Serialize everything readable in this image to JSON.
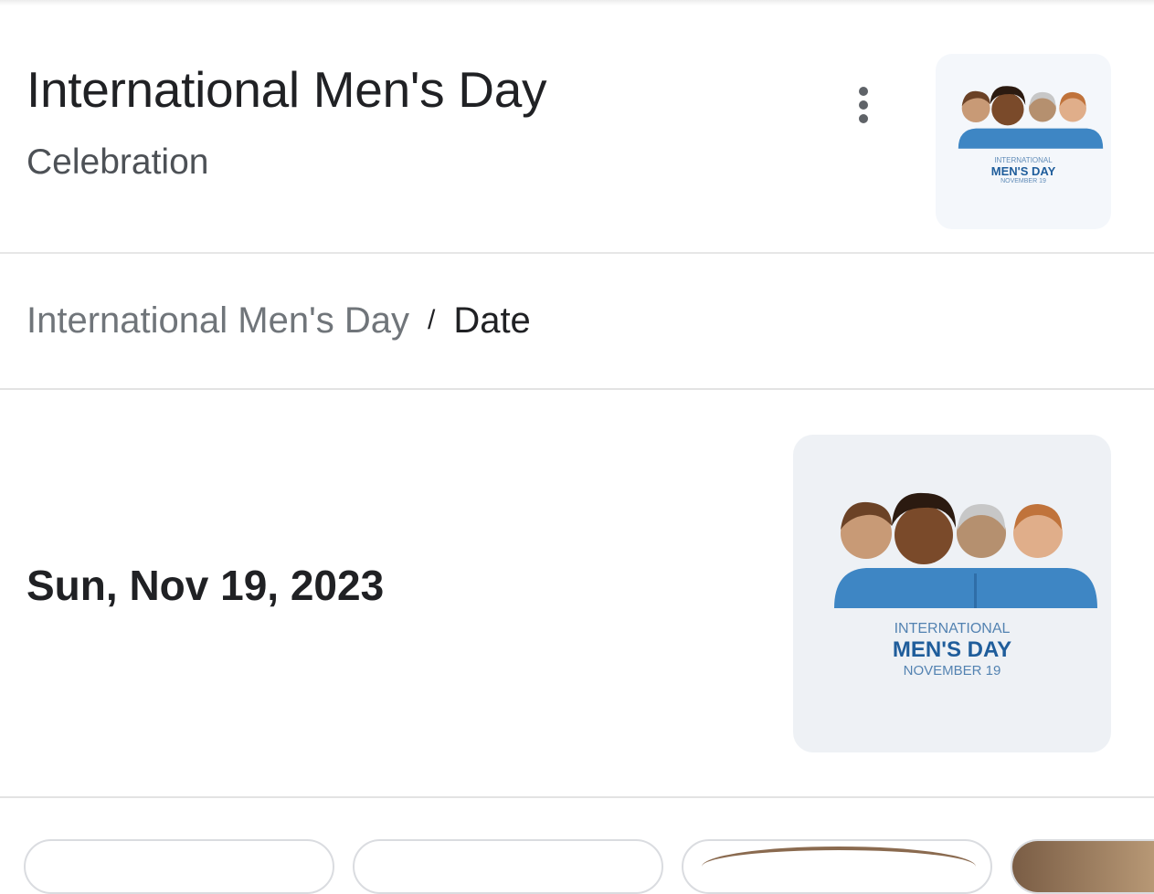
{
  "header": {
    "title": "International Men's Day",
    "subtitle": "Celebration",
    "more_icon": "more-vert-icon"
  },
  "thumbnail_text": {
    "line1": "INTERNATIONAL",
    "line2": "MEN'S DAY",
    "line3": "NOVEMBER 19"
  },
  "breadcrumb": {
    "parent": "International Men's Day",
    "separator": "/",
    "current": "Date"
  },
  "answer": {
    "date": "Sun, Nov 19, 2023"
  },
  "colors": {
    "shirt": "#3e86c4",
    "title_text": "#1f5d9b",
    "muted_text": "#70757a"
  }
}
